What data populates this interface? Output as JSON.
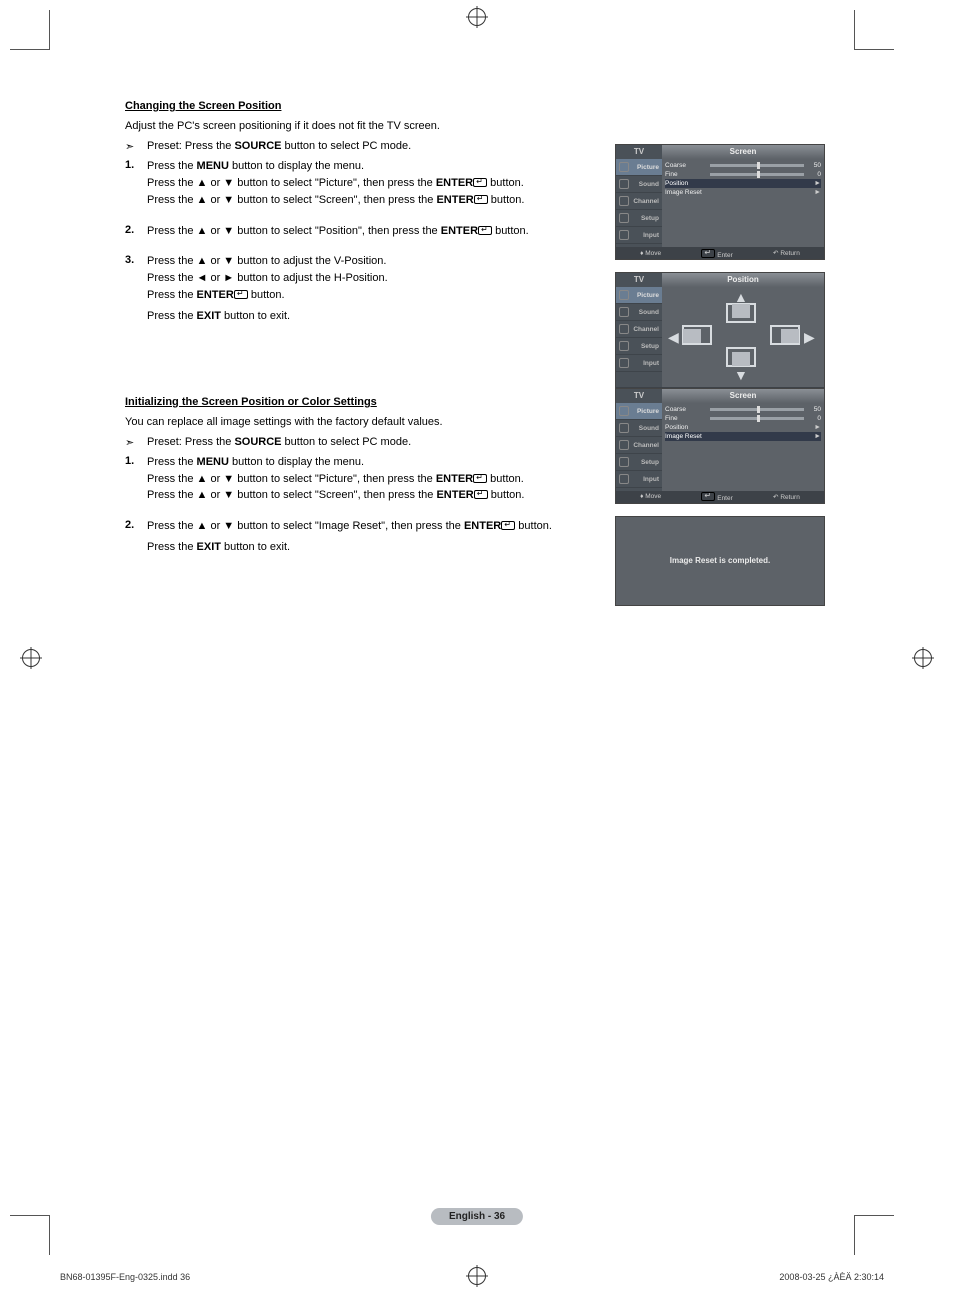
{
  "section1": {
    "heading": "Changing the Screen Position",
    "intro": "Adjust the PC's screen positioning if it does not fit the TV screen.",
    "preset_pre": "Preset: Press the ",
    "preset_bold": "SOURCE",
    "preset_post": " button to select PC mode.",
    "step1": {
      "l1_pre": "Press the ",
      "l1_b": "MENU",
      "l1_post": " button to display the menu.",
      "l2_pre": "Press the ▲ or ▼ button to select \"Picture\", then press the ",
      "l2_b": "ENTER",
      "l2_post": " button.",
      "l3_pre": "Press the ▲ or ▼ button to select \"Screen\", then press the ",
      "l3_b": "ENTER",
      "l3_post": " button."
    },
    "step2": {
      "l1_pre": "Press the ▲ or ▼ button to select \"Position\", then press the ",
      "l1_b": "ENTER",
      "l1_post": " button."
    },
    "step3": {
      "l1": "Press the ▲ or ▼ button to adjust the V-Position.",
      "l2": "Press the ◄ or ► button to adjust the H-Position.",
      "l3_pre": "Press the ",
      "l3_b": "ENTER",
      "l3_post": " button.",
      "exit_pre": "Press the ",
      "exit_b": "EXIT",
      "exit_post": " button to exit."
    }
  },
  "section2": {
    "heading": "Initializing the Screen Position or Color Settings",
    "intro": "You can replace all image settings with the factory default values.",
    "preset_pre": "Preset: Press the ",
    "preset_bold": "SOURCE",
    "preset_post": " button to select PC mode.",
    "step1": {
      "l1_pre": "Press the ",
      "l1_b": "MENU",
      "l1_post": " button to display the menu.",
      "l2_pre": "Press the ▲ or ▼ button to select \"Picture\", then press the ",
      "l2_b": "ENTER",
      "l2_post": " button.",
      "l3_pre": "Press the ▲ or ▼ button to select \"Screen\", then press the ",
      "l3_b": "ENTER",
      "l3_post": " button."
    },
    "step2": {
      "l1_pre": "Press the ▲ or ▼ button to select \"Image Reset\", then press the ",
      "l1_b": "ENTER",
      "l1_post": " button.",
      "exit_pre": "Press the ",
      "exit_b": "EXIT",
      "exit_post": " button to exit."
    }
  },
  "osd": {
    "tv": "TV",
    "screen_title": "Screen",
    "position_title": "Position",
    "sidebar": {
      "picture": "Picture",
      "sound": "Sound",
      "channel": "Channel",
      "setup": "Setup",
      "input": "Input"
    },
    "rows": {
      "coarse": {
        "label": "Coarse",
        "value": "50"
      },
      "fine": {
        "label": "Fine",
        "value": "0"
      },
      "position": {
        "label": "Position",
        "tri": "►"
      },
      "image_reset": {
        "label": "Image Reset",
        "tri": "►"
      }
    },
    "footer": {
      "move": "Move",
      "enter": "Enter",
      "return": "Return"
    },
    "reset_msg": "Image Reset is completed."
  },
  "page_label": "English - 36",
  "footer_left": "BN68-01395F-Eng-0325.indd   36",
  "footer_right": "2008-03-25   ¿ÀÈÄ 2:30:14"
}
